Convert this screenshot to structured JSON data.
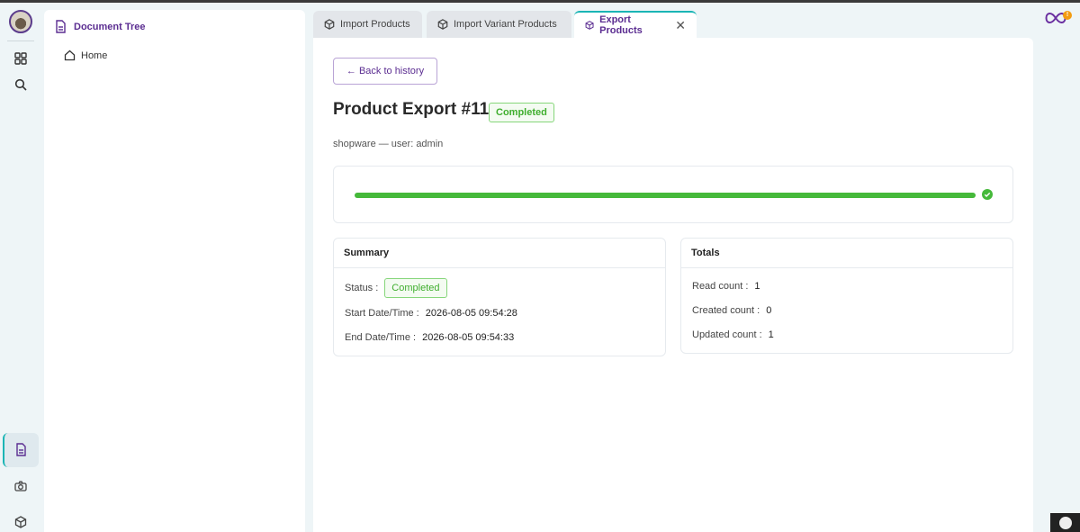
{
  "sidebar": {
    "icons": [
      "dashboard-icon",
      "search-icon",
      "document-icon",
      "camera-icon",
      "cube-icon"
    ]
  },
  "tree": {
    "title": "Document Tree",
    "home_label": "Home"
  },
  "tabs": [
    {
      "label": "Import Products"
    },
    {
      "label": "Import Variant Products"
    },
    {
      "label": "Export Products",
      "close": "✕"
    }
  ],
  "main": {
    "back_label": "← Back to history",
    "title": "Product Export #11",
    "status_badge": "Completed",
    "subline": "shopware — user: admin",
    "progress_fraction": 1.0
  },
  "summary": {
    "heading": "Summary",
    "status_label": "Status :",
    "status_value": "Completed",
    "start_label": "Start Date/Time :",
    "start_value": "2026-08-05 09:54:28",
    "end_label": "End Date/Time :",
    "end_value": "2026-08-05 09:54:33"
  },
  "totals": {
    "heading": "Totals",
    "read_label": "Read count :",
    "read_value": "1",
    "created_label": "Created count :",
    "created_value": "0",
    "updated_label": "Updated count :",
    "updated_value": "1"
  },
  "corner": {
    "notification_count": "!"
  },
  "colors": {
    "accent": "#5b2d91",
    "teal": "#1bb5b5",
    "success": "#45b93a"
  }
}
